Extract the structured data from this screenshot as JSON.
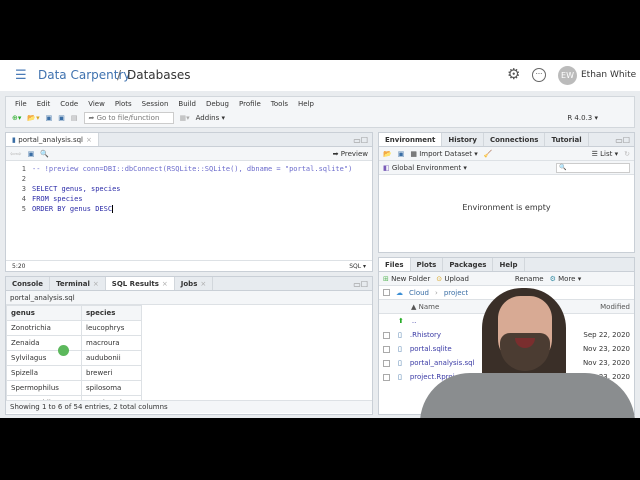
{
  "header": {
    "workspace": "Data Carpentry",
    "separator": "/",
    "project": "Databases",
    "user_initials": "EW",
    "user_name": "Ethan White"
  },
  "menu": [
    "File",
    "Edit",
    "Code",
    "View",
    "Plots",
    "Session",
    "Build",
    "Debug",
    "Profile",
    "Tools",
    "Help"
  ],
  "toolbar": {
    "goto_placeholder": "Go to file/function",
    "addins": "Addins",
    "r_version": "R 4.0.3"
  },
  "editor": {
    "tab": "portal_analysis.sql",
    "preview": "Preview",
    "lines": [
      "-- !preview conn=DBI::dbConnect(RSQLite::SQLite(), dbname = \"portal.sqlite\")",
      "",
      "SELECT genus, species",
      "FROM species",
      "ORDER BY genus DESC"
    ],
    "line_numbers": [
      "1",
      "2",
      "3",
      "4",
      "5"
    ],
    "cursor_pos": "5:20",
    "file_type": "SQL"
  },
  "console": {
    "tabs": [
      "Console",
      "Terminal",
      "SQL Results",
      "Jobs"
    ],
    "source": "portal_analysis.sql",
    "columns": [
      "genus",
      "species"
    ],
    "rows": [
      [
        "Zonotrichia",
        "leucophrys"
      ],
      [
        "Zenaida",
        "macroura"
      ],
      [
        "Sylvilagus",
        "audubonii"
      ],
      [
        "Spizella",
        "breweri"
      ],
      [
        "Spermophilus",
        "spilosoma"
      ],
      [
        "Spermophilus",
        "tereticaudus"
      ]
    ],
    "footer": "Showing 1 to 6 of 54 entries, 2 total columns"
  },
  "environment": {
    "tabs": [
      "Environment",
      "History",
      "Connections",
      "Tutorial"
    ],
    "import": "Import Dataset",
    "list": "List",
    "scope": "Global Environment",
    "empty": "Environment is empty"
  },
  "files": {
    "tabs": [
      "Files",
      "Plots",
      "Packages",
      "Help"
    ],
    "new_folder": "New Folder",
    "upload": "Upload",
    "rename": "Rename",
    "more": "More",
    "crumbs": [
      "Cloud",
      "project"
    ],
    "col_name": "Name",
    "col_modified": "Modified",
    "items": [
      {
        "name": "..",
        "modified": ""
      },
      {
        "name": ".Rhistory",
        "modified": "Sep 22, 2020"
      },
      {
        "name": "portal.sqlite",
        "modified": "Nov 23, 2020"
      },
      {
        "name": "portal_analysis.sql",
        "modified": "Nov 23, 2020"
      },
      {
        "name": "project.Rproj",
        "modified": "Nov 23, 2020"
      }
    ]
  }
}
